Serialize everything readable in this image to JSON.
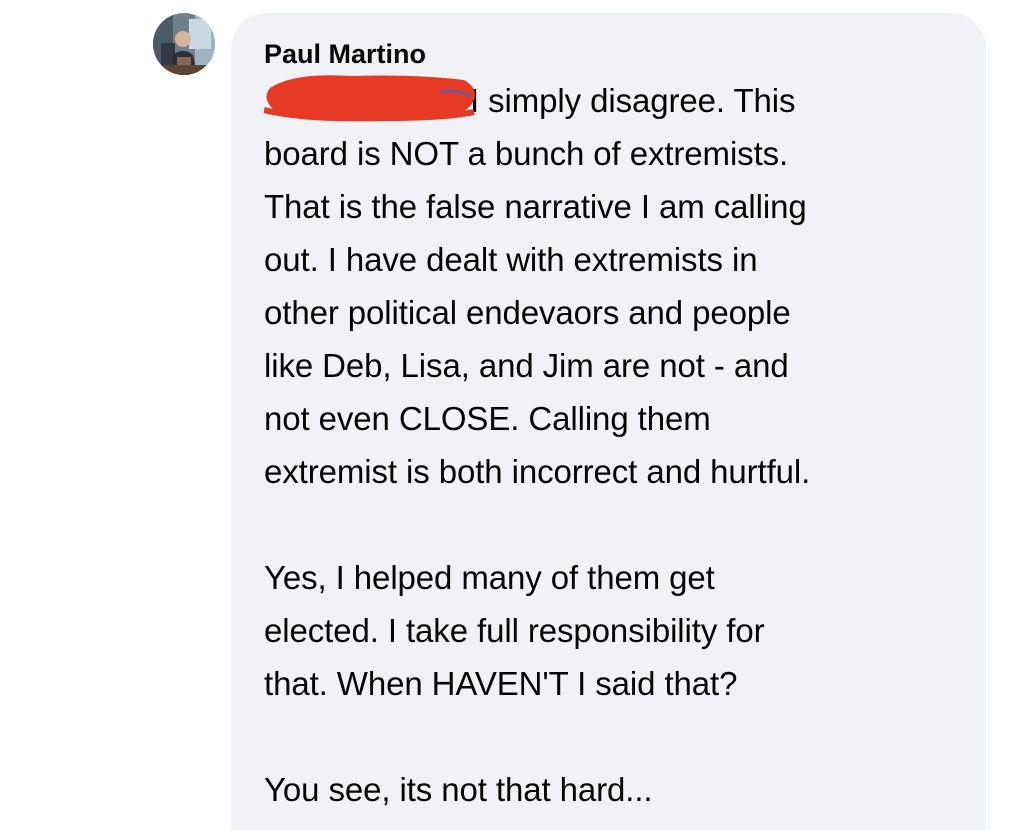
{
  "comment": {
    "author": "Paul Martino",
    "paragraphs": [
      {
        "lines": [
          "I simply disagree. This",
          "board is NOT a bunch of extremists.",
          "That is the false narrative I am calling",
          "out.  I have dealt with extremists in",
          "other political endevaors and people",
          "like Deb, Lisa, and Jim are not - and",
          "not even CLOSE. Calling them",
          "extremist is both incorrect and hurtful."
        ]
      },
      {
        "lines": [
          "Yes, I helped many of them get",
          "elected. I take full responsibility for",
          "that. When HAVEN'T I said that?"
        ]
      },
      {
        "lines": [
          "You see, its not that hard..."
        ]
      }
    ]
  },
  "colors": {
    "bubble_background": "#f0f2f5",
    "text": "#050505",
    "redaction": "#e63a25",
    "mention_link": "#216fdb"
  },
  "icons": {
    "avatar": "profile-photo-avatar",
    "redaction": "red-scribble-redaction-mark"
  }
}
